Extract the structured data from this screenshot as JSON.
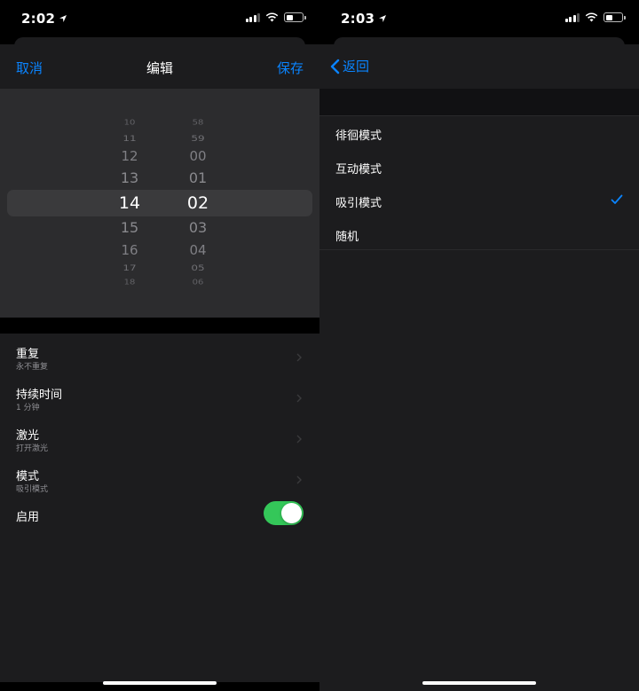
{
  "left": {
    "status_time": "2:02",
    "nav": {
      "cancel": "取消",
      "title": "编辑",
      "save": "保存"
    },
    "picker": {
      "hours": [
        "10",
        "11",
        "12",
        "13",
        "14",
        "15",
        "16",
        "17",
        "18"
      ],
      "minutes": [
        "58",
        "59",
        "00",
        "01",
        "02",
        "03",
        "04",
        "05",
        "06"
      ],
      "selected_hour": "14",
      "selected_minute": "02"
    },
    "settings": [
      {
        "title": "重复",
        "subtitle": "永不重复"
      },
      {
        "title": "持续时间",
        "subtitle": "1 分钟"
      },
      {
        "title": "激光",
        "subtitle": "打开激光"
      },
      {
        "title": "模式",
        "subtitle": "吸引模式"
      }
    ],
    "enable": {
      "label": "启用",
      "on": true
    }
  },
  "right": {
    "status_time": "2:03",
    "back_label": "返回",
    "modes": [
      "徘徊模式",
      "互动模式",
      "吸引模式",
      "随机"
    ],
    "selected_mode": "吸引模式"
  },
  "colors": {
    "accent": "#0a84ff",
    "toggle_on": "#34c759",
    "background": "#000000",
    "surface": "#1c1c1e"
  }
}
